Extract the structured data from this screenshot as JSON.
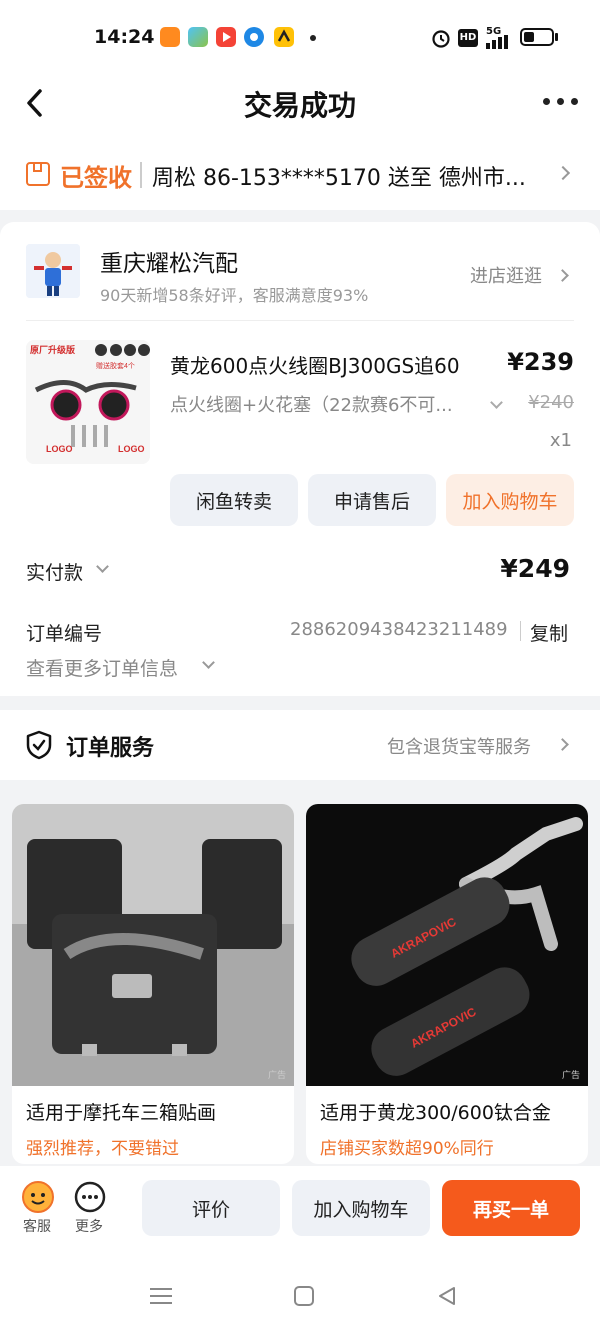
{
  "status_bar": {
    "time": "14:24",
    "network": "5G",
    "hd": "HD",
    "icons": [
      "alarm-icon",
      "hd-icon",
      "signal-icon",
      "battery-icon"
    ]
  },
  "header": {
    "title": "交易成功"
  },
  "delivery": {
    "status": "已签收",
    "info": "周松  86-153****5170  送至  德州市..."
  },
  "shop": {
    "name": "重庆耀松汽配",
    "subtitle": "90天新增58条好评，客服满意度93%",
    "link": "进店逛逛"
  },
  "product": {
    "title": "黄龙600点火线圈BJ300GS追60",
    "price": "¥239",
    "spec": "点火线圈+火花塞（22款赛6不可...",
    "original_price": "¥240",
    "quantity": "x1",
    "image_texts": {
      "badge": "原厂升级版",
      "gift": "赠送胶套4个",
      "logo": "LOGO"
    }
  },
  "product_actions": {
    "resell": "闲鱼转卖",
    "aftersale": "申请售后",
    "add_cart": "加入购物车"
  },
  "payment": {
    "label": "实付款",
    "value": "¥249"
  },
  "order": {
    "label": "订单编号",
    "number": "2886209438423211489",
    "copy": "复制",
    "more_info": "查看更多订单信息"
  },
  "services": {
    "title": "订单服务",
    "link": "包含退货宝等服务"
  },
  "recommendations": [
    {
      "title": "适用于摩托车三箱贴画",
      "subtitle": "强烈推荐，不要错过",
      "ad": "广告"
    },
    {
      "title": "适用于黄龙300/600钛合金",
      "subtitle": "店铺买家数超90%同行",
      "ad": "广告",
      "brand": "AKRAPOVIC"
    }
  ],
  "action_bar": {
    "service_label": "客服",
    "more_label": "更多",
    "review": "评价",
    "add_cart": "加入购物车",
    "rebuy": "再买一单"
  },
  "colors": {
    "accent": "#f0722b",
    "cart_bg": "#fdeee4",
    "button_bg": "#eef1f6",
    "rebuy_bg": "#f55a1c"
  }
}
